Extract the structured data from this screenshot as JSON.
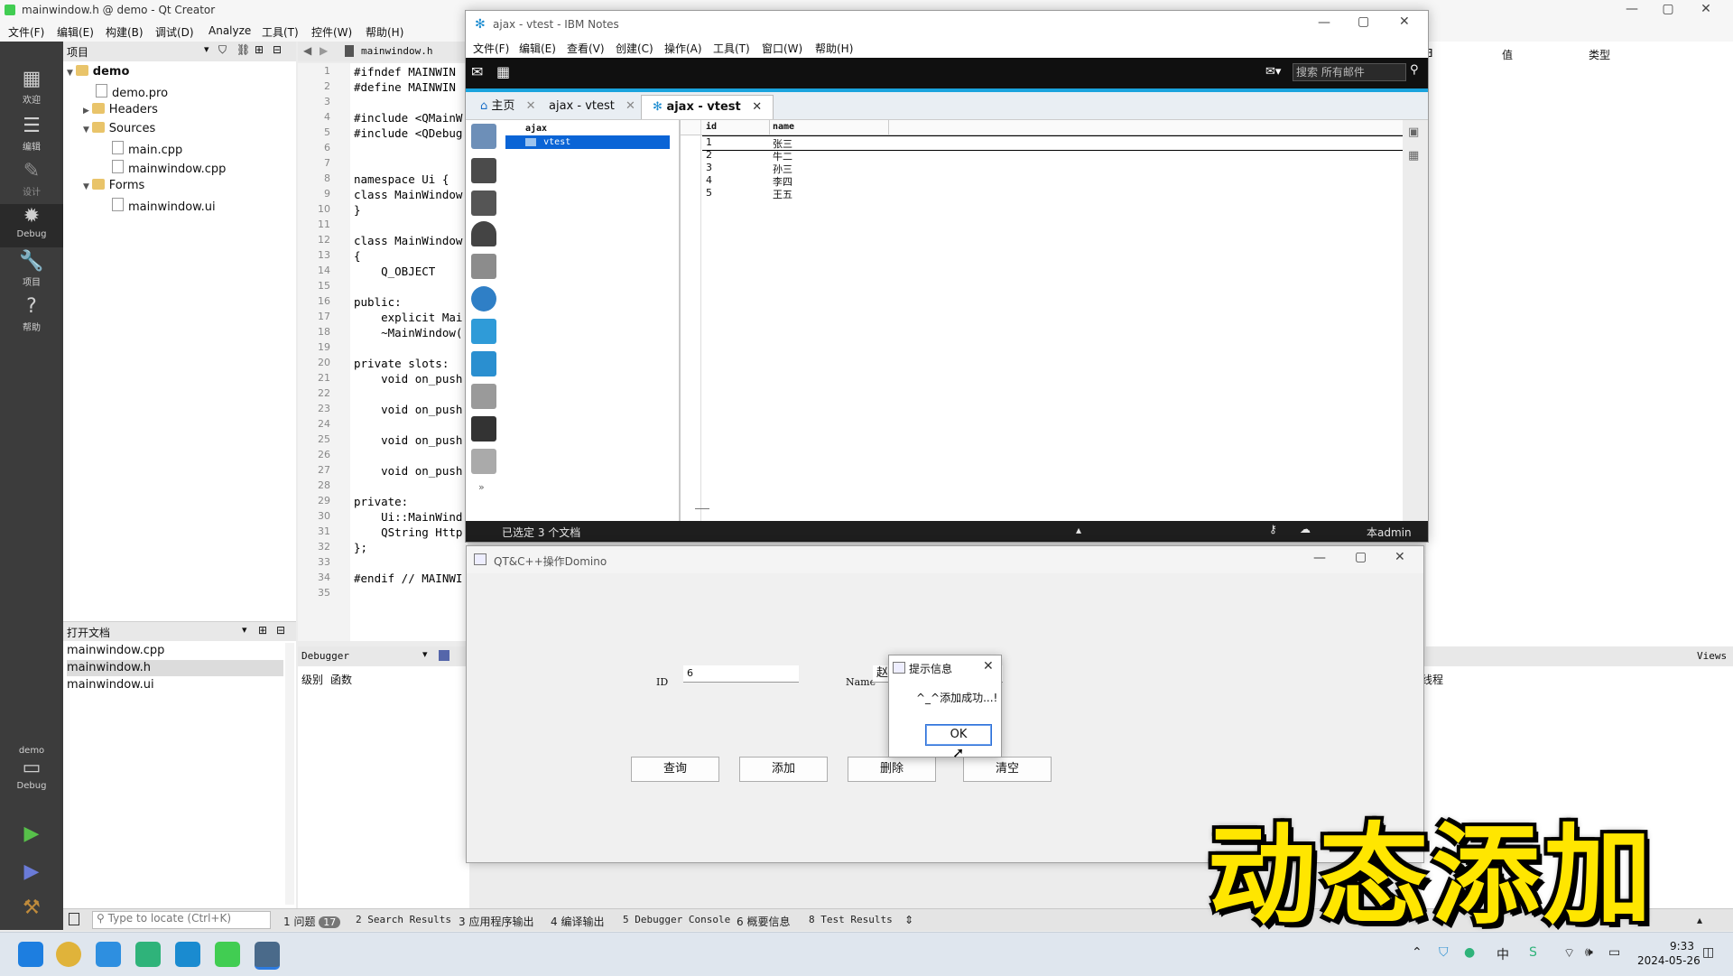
{
  "qtcreator": {
    "title": "mainwindow.h @ demo - Qt Creator",
    "menu": [
      "文件(F)",
      "编辑(E)",
      "构建(B)",
      "调试(D)",
      "Analyze",
      "工具(T)",
      "控件(W)",
      "帮助(H)"
    ],
    "modes": [
      {
        "label": "欢迎",
        "icon": "welcome-icon"
      },
      {
        "label": "编辑",
        "icon": "edit-icon"
      },
      {
        "label": "设计",
        "icon": "design-icon"
      },
      {
        "label": "Debug",
        "icon": "debug-icon"
      },
      {
        "label": "项目",
        "icon": "projects-icon"
      },
      {
        "label": "帮助",
        "icon": "help-icon"
      }
    ],
    "kit_label": "demo",
    "kit_mode": "Debug",
    "project_panel_title": "项目",
    "tree": [
      {
        "label": "demo",
        "type": "folder",
        "depth": 0
      },
      {
        "label": "demo.pro",
        "type": "file",
        "depth": 1
      },
      {
        "label": "Headers",
        "type": "folder",
        "depth": 1
      },
      {
        "label": "Sources",
        "type": "folder",
        "depth": 1
      },
      {
        "label": "main.cpp",
        "type": "file",
        "depth": 2
      },
      {
        "label": "mainwindow.cpp",
        "type": "file",
        "depth": 2
      },
      {
        "label": "Forms",
        "type": "folder",
        "depth": 1
      },
      {
        "label": "mainwindow.ui",
        "type": "file",
        "depth": 2
      }
    ],
    "open_docs_title": "打开文档",
    "open_docs": [
      "mainwindow.cpp",
      "mainwindow.h",
      "mainwindow.ui"
    ],
    "open_docs_selected": 1,
    "editor_tab": "mainwindow.h",
    "code_lines": [
      "#ifndef MAINWIN",
      "#define MAINWIN",
      "",
      "#include <QMainW",
      "#include <QDebug",
      "",
      "",
      "namespace Ui {",
      "class MainWindow",
      "}",
      "",
      "class MainWindow",
      "{",
      "    Q_OBJECT",
      "",
      "public:",
      "    explicit Mai",
      "    ~MainWindow(",
      "",
      "private slots:",
      "    void on_push",
      "",
      "    void on_push",
      "",
      "    void on_push",
      "",
      "    void on_push",
      "",
      "private:",
      "    Ui::MainWind",
      "    QString Http",
      "};",
      "",
      "#endif // MAINWI",
      ""
    ],
    "debugger_label": "Debugger",
    "debugger_cols": [
      "级别",
      "函数"
    ],
    "right_cols": [
      "值",
      "类型"
    ],
    "right_lower_label": "Views",
    "right_lower_text": "线程",
    "locate_placeholder": "Type to locate (Ctrl+K)",
    "output_panes": [
      {
        "label": "1 问题",
        "badge": "17"
      },
      {
        "label": "2 Search Results"
      },
      {
        "label": "3 应用程序输出"
      },
      {
        "label": "4 编译输出"
      },
      {
        "label": "5 Debugger Console"
      },
      {
        "label": "6 概要信息"
      },
      {
        "label": "8 Test Results"
      }
    ]
  },
  "notes": {
    "title": "ajax - vtest - IBM Notes",
    "menu": [
      "文件(F)",
      "编辑(E)",
      "查看(V)",
      "创建(C)",
      "操作(A)",
      "工具(T)",
      "窗口(W)",
      "帮助(H)"
    ],
    "search_placeholder": "搜索 所有邮件",
    "tabs": [
      {
        "label": "主页",
        "icon": "home-icon"
      },
      {
        "label": "ajax - vtest"
      },
      {
        "label": "ajax - vtest",
        "active": true
      }
    ],
    "nav": {
      "db": "ajax",
      "view": "vtest"
    },
    "view_columns": [
      "id",
      "name"
    ],
    "rows": [
      {
        "id": "1",
        "name": "张三"
      },
      {
        "id": "2",
        "name": "牛二"
      },
      {
        "id": "3",
        "name": "孙三"
      },
      {
        "id": "4",
        "name": "李四"
      },
      {
        "id": "5",
        "name": "王五"
      }
    ],
    "status_selected": "已选定 3 个文档",
    "status_user": "本admin"
  },
  "domino_app": {
    "title": "QT&C++操作Domino",
    "id_label": "ID",
    "id_value": "6",
    "name_label": "Name",
    "name_value": "赵",
    "buttons": [
      "查询",
      "添加",
      "删除",
      "清空"
    ]
  },
  "message_box": {
    "title": "提示信息",
    "text": "^_^添加成功...!",
    "ok": "OK"
  },
  "overlay_caption": "动态添加",
  "taskbar": {
    "time": "9:33",
    "date": "2024-05-26"
  },
  "colors": {
    "qt_sidebar": "#3c3c3c",
    "notes_toolbar": "#101010",
    "selection_blue": "#0a64d6",
    "caption_yellow": "#ffe600"
  }
}
